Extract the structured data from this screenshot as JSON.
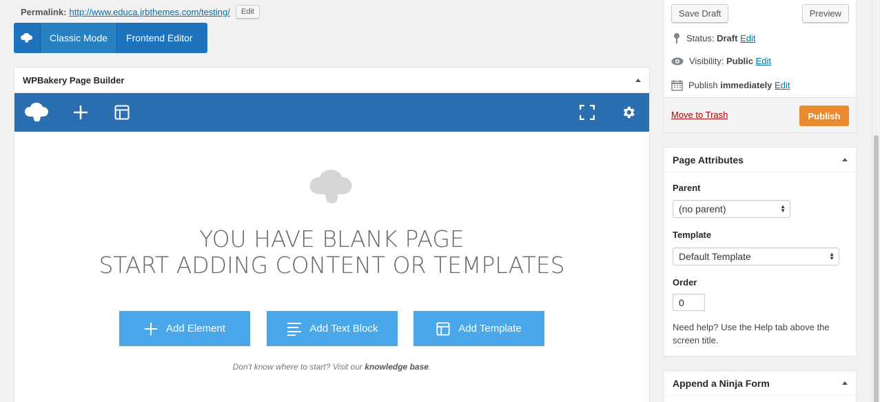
{
  "permalink": {
    "label": "Permalink:",
    "url": "http://www.educa.jrbthemes.com/testing/",
    "edit_label": "Edit"
  },
  "modes": {
    "classic": "Classic Mode",
    "frontend": "Frontend Editor"
  },
  "builder": {
    "title": "WPBakery Page Builder",
    "headline_line1": "YOU HAVE BLANK PAGE",
    "headline_line2": "START ADDING CONTENT OR TEMPLATES",
    "buttons": {
      "add_element": "Add Element",
      "add_text_block": "Add Text Block",
      "add_template": "Add Template"
    },
    "hint_prefix": "Don't know where to start? Visit our",
    "hint_link": "knowledge base",
    "hint_suffix": "."
  },
  "publish": {
    "save_draft": "Save Draft",
    "preview": "Preview",
    "status_label": "Status:",
    "status_value": "Draft",
    "visibility_label": "Visibility:",
    "visibility_value": "Public",
    "publish_label": "Publish",
    "publish_value": "immediately",
    "edit": "Edit",
    "move_to_trash": "Move to Trash",
    "publish_button": "Publish"
  },
  "page_attributes": {
    "title": "Page Attributes",
    "parent_label": "Parent",
    "parent_value": "(no parent)",
    "template_label": "Template",
    "template_value": "Default Template",
    "order_label": "Order",
    "order_value": "0",
    "help_text": "Need help? Use the Help tab above the screen title."
  },
  "ninja": {
    "title": "Append a Ninja Form"
  },
  "colors": {
    "builder_blue": "#2b6fb0",
    "cta_blue": "#4aa8ea",
    "publish_orange": "#ea8a2e",
    "link_blue": "#0073aa"
  }
}
